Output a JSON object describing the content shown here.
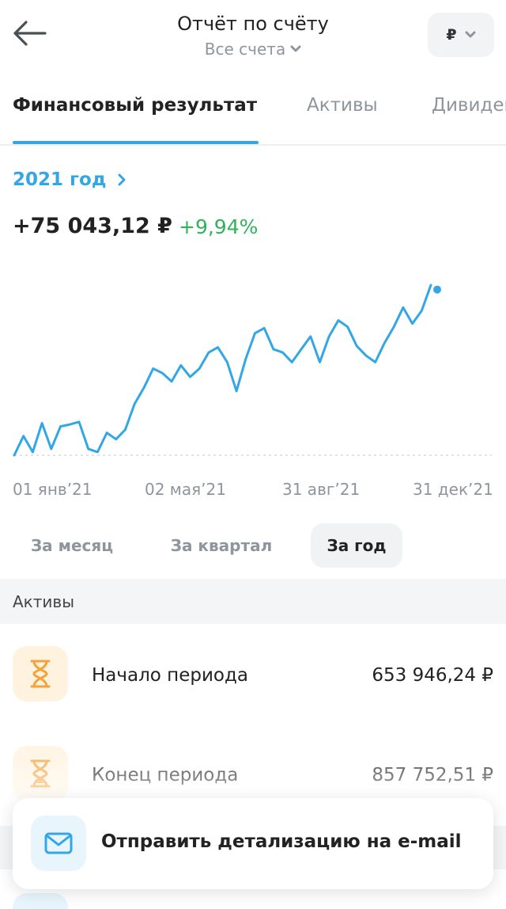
{
  "header": {
    "back_icon": "arrow-left-icon",
    "title": "Отчёт по счёту",
    "subtitle": "Все счета",
    "currency": "₽"
  },
  "tabs": [
    {
      "label": "Финансовый результат",
      "active": true
    },
    {
      "label": "Активы",
      "active": false
    },
    {
      "label": "Дивиденды",
      "active": false
    }
  ],
  "summary": {
    "period": "2021 год",
    "result": "+75 043,12 ₽",
    "percent": "+9,94%"
  },
  "chart_data": {
    "type": "line",
    "x_labels": [
      "01 янв’21",
      "02 мая’21",
      "31 авг’21",
      "31 дек’21"
    ],
    "series": [
      {
        "values": [
          0,
          3,
          0.5,
          5,
          1,
          4.5,
          4.8,
          5.2,
          1,
          0.5,
          3.5,
          2.5,
          4,
          8,
          10.5,
          13.5,
          12.8,
          11.5,
          14,
          12.2,
          13.5,
          16,
          16.8,
          14.5,
          10,
          15,
          19,
          19.8,
          16.5,
          16,
          14.5,
          16.5,
          18.5,
          14.5,
          18.5,
          21,
          20,
          17,
          15.5,
          14.5,
          17.5,
          20,
          23,
          20.5,
          22.5,
          26.5,
          25.8
        ]
      }
    ],
    "color": "#33a7e6",
    "grid": false
  },
  "periods": [
    {
      "label": "За месяц",
      "active": false
    },
    {
      "label": "За квартал",
      "active": false
    },
    {
      "label": "За год",
      "active": true
    }
  ],
  "assets": {
    "title": "Активы",
    "rows": [
      {
        "icon": "hourglass-icon",
        "label": "Начало периода",
        "value": "653 946,24 ₽"
      },
      {
        "icon": "hourglass-icon",
        "label": "Конец периода",
        "value": "857 752,51 ₽"
      }
    ]
  },
  "email_card": {
    "icon": "mail-icon",
    "label": "Отправить детализацию на e-mail"
  },
  "colors": {
    "accent": "#33a7e6",
    "positive": "#2fb35b",
    "icon_bg_orange": "#fff3e0",
    "icon_orange": "#f4a23a"
  }
}
